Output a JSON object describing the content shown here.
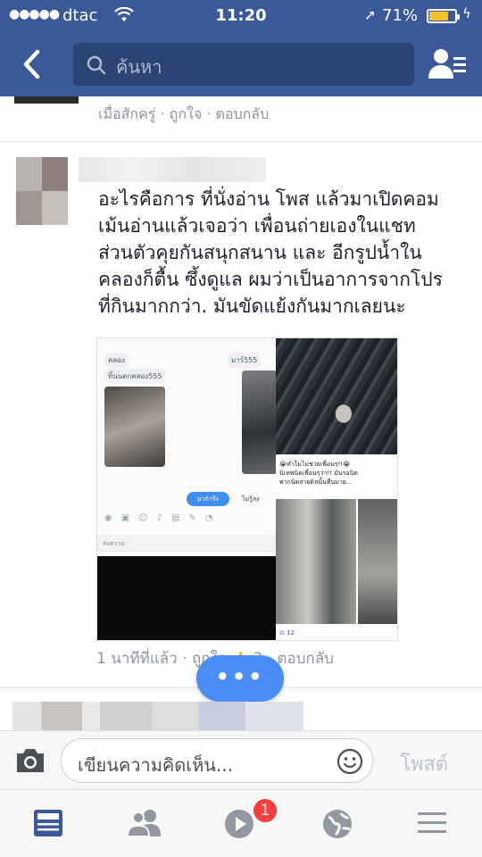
{
  "status_bar": {
    "signal": "●●●●●",
    "carrier": "dtac",
    "time": "11:20",
    "location_arrow": "➚",
    "battery_percent": "71%",
    "battery_level": 0.71
  },
  "nav": {
    "back_icon": "chevron-left-icon",
    "search_placeholder": "ค้นหา",
    "friends_icon": "friend-requests-icon"
  },
  "previous_comment": {
    "meta": "เมื่อสักครู่ · ถูกใจ · ตอบกลับ"
  },
  "comment": {
    "text_lines": [
      "อะไรคือการ ที่นั่งอ่าน โพส แล้วมาเปิดคอม",
      "เม้นอ่านแล้วเจอว่า เพื่อนถ่ายเองในแชท",
      "ส่วนตัวคุยกันสนุกสนาน และ อีกรูปน้ำใน",
      "คลองก็ตื้น ซึ้งดูแล ผมว่าเป็นอาการจากโปร",
      "ที่กินมากกว่า. มันขัดแย้งกันมากเลยนะ"
    ],
    "attachment": {
      "chat_top_left": "คลอง",
      "chat_bubble": "ทิ้นนตกคลอง555",
      "chat_top_right": "มาร์555",
      "chat_send": "มาถ้ารึง",
      "chat_reply": "ไม่รู้ลง",
      "chat_bar": "ส่งความ",
      "caption_1": "😭ทำไมไม่ช่วยเพื่อนๆ!!😭",
      "caption_2": "นิเทพนิดเพื่อนๆว่า!! มันรอนิด",
      "caption_3": "พากนิดสายดิลนั้นที่นมาย...",
      "small_stat": "⊙ 12"
    },
    "meta_time": "1 นาทีที่แล้ว",
    "meta_like": "ถูกใจ",
    "meta_like_count": "3",
    "meta_reply": "ตอบกลับ"
  },
  "typing_indicator": "•••",
  "composer": {
    "placeholder": "เขียนความคิดเห็น...",
    "post_label": "โพสต์"
  },
  "tabbar": {
    "tabs": [
      "news-feed-icon",
      "friends-icon",
      "video-icon",
      "globe-notifications-icon",
      "menu-icon"
    ],
    "video_badge": "1"
  },
  "colors": {
    "facebook_blue": "#3b5998",
    "badge_red": "#fa3e3e",
    "typing_blue": "#4b8cf5"
  }
}
